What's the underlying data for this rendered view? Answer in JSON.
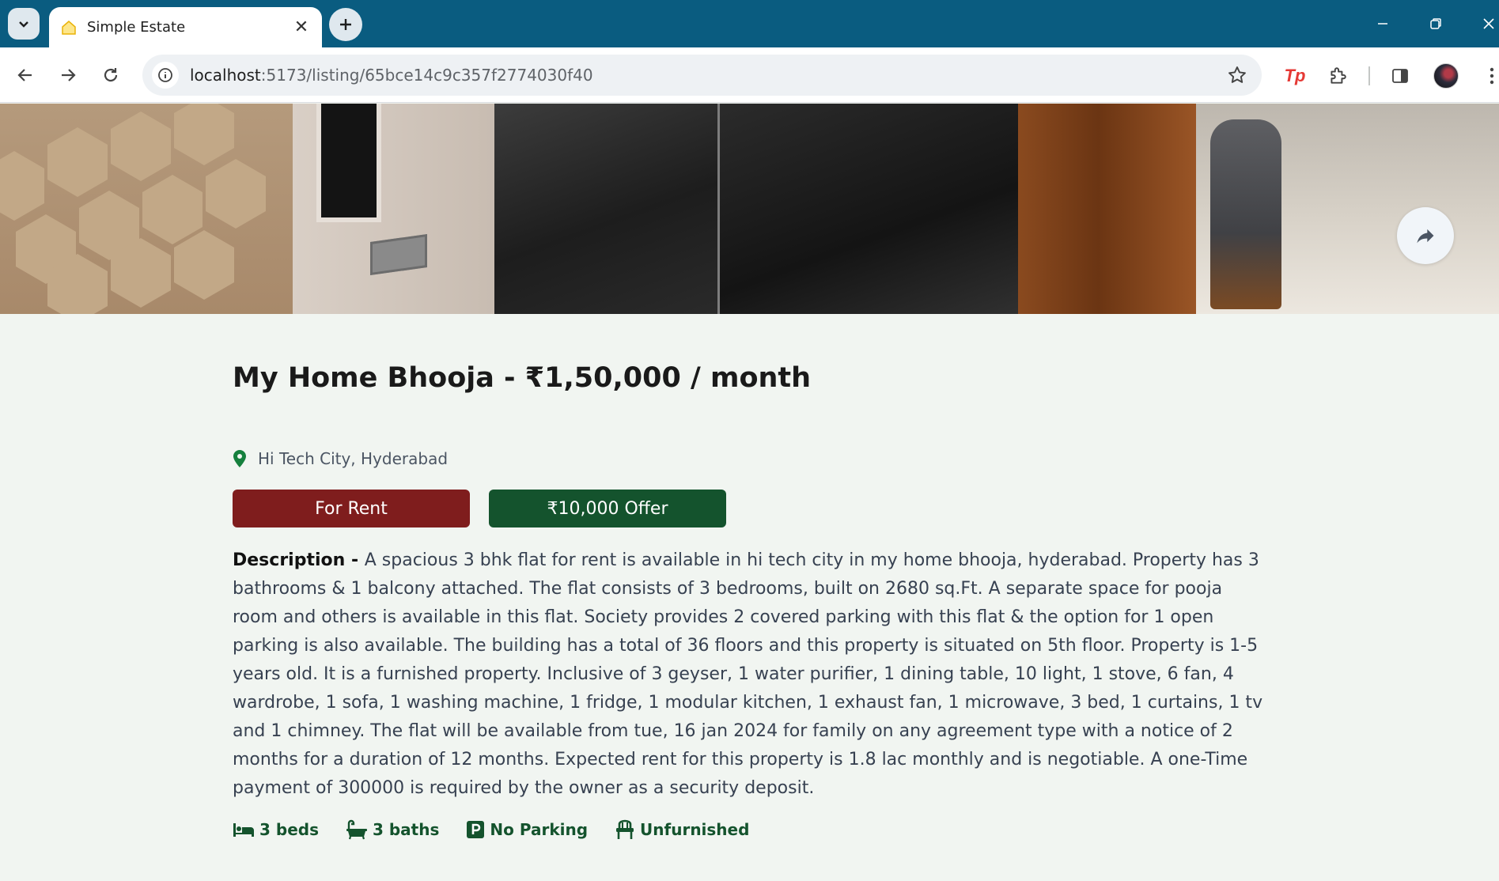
{
  "browser": {
    "tab_title": "Simple Estate",
    "url_host": "localhost",
    "url_path": ":5173/listing/65bce14c9c357f2774030f40"
  },
  "listing": {
    "title": "My Home Bhooja - ₹1,50,000 / month",
    "location": "Hi Tech City, Hyderabad",
    "type_badge": "For Rent",
    "offer_badge": "₹10,000 Offer",
    "description_label": "Description - ",
    "description": "A spacious 3 bhk flat for rent is available in hi tech city in my home bhooja, hyderabad. Property has 3 bathrooms & 1 balcony attached. The flat consists of 3 bedrooms, built on 2680 sq.Ft. A separate space for pooja room and others is available in this flat. Society provides 2 covered parking with this flat & the option for 1 open parking is also available. The building has a total of 36 floors and this property is situated on 5th floor. Property is 1-5 years old. It is a furnished property. Inclusive of 3 geyser, 1 water purifier, 1 dining table, 10 light, 1 stove, 6 fan, 4 wardrobe, 1 sofa, 1 washing machine, 1 fridge, 1 modular kitchen, 1 exhaust fan, 1 microwave, 3 bed, 1 curtains, 1 tv and 1 chimney. The flat will be available from tue, 16 jan 2024 for family on any agreement type with a notice of 2 months for a duration of 12 months. Expected rent for this property is 1.8 lac monthly and is negotiable. A one-Time payment of 300000 is required by the owner as a security deposit.",
    "features": {
      "beds": "3 beds",
      "baths": "3 baths",
      "parking": "No Parking",
      "furnished": "Unfurnished"
    }
  },
  "icons": {
    "share": "share-icon",
    "location": "map-pin-icon",
    "beds": "bed-icon",
    "baths": "bath-icon",
    "parking": "parking-icon",
    "furnished": "chair-icon"
  },
  "colors": {
    "rent_badge": "#7f1d1d",
    "offer_badge": "#14532d",
    "feature_text": "#14532d",
    "page_bg": "#f1f5f1",
    "tabbar": "#0a5c80"
  }
}
